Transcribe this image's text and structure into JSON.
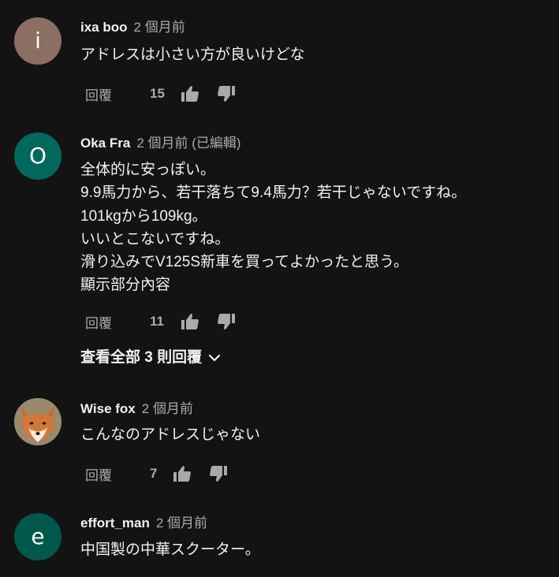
{
  "comments": [
    {
      "avatar_letter": "i",
      "avatar_color": "#8d6e63",
      "author": "ixa boo",
      "time": "2 個月前",
      "lines": [
        "アドレスは小さい方が良いけどな"
      ],
      "reply_label": "回覆",
      "likes": "15"
    },
    {
      "avatar_letter": "O",
      "avatar_color": "#00695c",
      "author": "Oka Fra",
      "time": "2 個月前 (已編輯)",
      "lines": [
        "全体的に安っぽい。",
        "9.9馬力から、若干落ちて9.4馬力？若干じゃないですね。",
        "101kgから109kg。",
        "いいとこないですね。",
        "滑り込みでV125S新車を買ってよかったと思う。",
        "顯示部分內容"
      ],
      "reply_label": "回覆",
      "likes": "11",
      "view_replies": "查看全部 3 則回覆"
    },
    {
      "avatar_letter": "",
      "avatar_image": "fox",
      "author": "Wise fox",
      "time": "2 個月前",
      "lines": [
        "こんなのアドレスじゃない"
      ],
      "reply_label": "回覆",
      "likes": "7"
    },
    {
      "avatar_letter": "e",
      "avatar_color": "#00574b",
      "author": "effort_man",
      "time": "2 個月前",
      "lines": [
        "中国製の中華スクーター。"
      ]
    }
  ]
}
